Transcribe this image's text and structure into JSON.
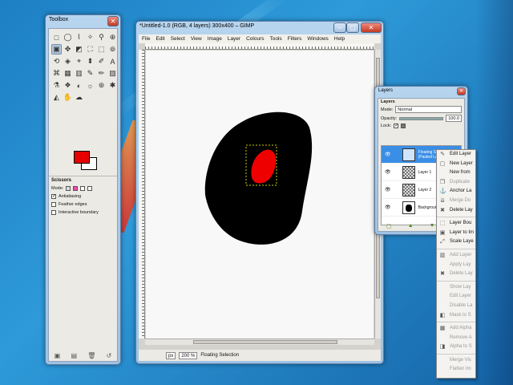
{
  "toolbox": {
    "title": "Toolbox",
    "tools": [
      "□",
      "◯",
      "⌇",
      "✧",
      "⚲",
      "⊕",
      "▣",
      "✥",
      "◩",
      "⛶",
      "⬚",
      "⊚",
      "⟲",
      "◈",
      "⌖",
      "⬍",
      "✐",
      "A",
      "⌘",
      "▦",
      "▥",
      "✎",
      "✏",
      "▨",
      "⚗",
      "❖",
      "◐",
      "☼",
      "⊛",
      "✱",
      "◭",
      "✋",
      "☁"
    ],
    "options_title": "Scissors",
    "mode_label": "Mode:",
    "antialiasing": "Antialiasing",
    "feather_edges": "Feather edges",
    "interactive_boundary": "Interactive boundary",
    "bottom_icons": [
      "▣",
      "▤",
      "🗑",
      "↺"
    ]
  },
  "image_window": {
    "title": "*Untitled-1.0 (RGB, 4 layers) 300x400 – GIMP",
    "menu": [
      "File",
      "Edit",
      "Select",
      "View",
      "Image",
      "Layer",
      "Colours",
      "Tools",
      "Filters",
      "Windows",
      "Help"
    ],
    "unit": "px",
    "zoom": "200 %",
    "status": "Floating Selection"
  },
  "layers_dock": {
    "title": "Layers",
    "tab": "Layers",
    "mode_label": "Mode:",
    "mode_value": "Normal",
    "opacity_label": "Opacity:",
    "opacity_value": "100.0",
    "opacity_fraction": 1.0,
    "lock_label": "Lock:",
    "layers": [
      {
        "name": "Floating Selection (Pasted Layer)",
        "selected": true
      },
      {
        "name": "Layer 1",
        "selected": false
      },
      {
        "name": "Layer 2",
        "selected": false
      },
      {
        "name": "Background",
        "selected": false
      }
    ]
  },
  "context_menu": [
    {
      "label": "Edit Layer",
      "disabled": false,
      "icon": "✎"
    },
    {
      "label": "New Layer",
      "disabled": false,
      "icon": "▢"
    },
    {
      "label": "New from",
      "disabled": false,
      "icon": ""
    },
    {
      "label": "Duplicate",
      "disabled": true,
      "icon": "❐"
    },
    {
      "label": "Anchor La",
      "disabled": false,
      "icon": "⚓"
    },
    {
      "label": "Merge Do",
      "disabled": true,
      "icon": "⇊"
    },
    {
      "label": "Delete Lay",
      "disabled": false,
      "icon": "✖"
    },
    {
      "label": "Layer Bou",
      "disabled": false,
      "icon": "⬚"
    },
    {
      "label": "Layer to Im",
      "disabled": false,
      "icon": "▣"
    },
    {
      "label": "Scale Laye",
      "disabled": false,
      "icon": "⤢"
    },
    {
      "label": "Add Layer",
      "disabled": true,
      "icon": "▥"
    },
    {
      "label": "Apply Lay",
      "disabled": true,
      "icon": ""
    },
    {
      "label": "Delete Lay",
      "disabled": true,
      "icon": "✖"
    },
    {
      "label": "Show Lay",
      "disabled": true,
      "icon": ""
    },
    {
      "label": "Edit Layer",
      "disabled": true,
      "icon": ""
    },
    {
      "label": "Disable La",
      "disabled": true,
      "icon": ""
    },
    {
      "label": "Mask to S",
      "disabled": true,
      "icon": "◧"
    },
    {
      "label": "Add Alpha",
      "disabled": true,
      "icon": "▦"
    },
    {
      "label": "Remove A",
      "disabled": true,
      "icon": ""
    },
    {
      "label": "Alpha to S",
      "disabled": true,
      "icon": "◨"
    },
    {
      "label": "Merge Vis",
      "disabled": true,
      "icon": ""
    },
    {
      "label": "Flatten Im",
      "disabled": true,
      "icon": ""
    }
  ]
}
